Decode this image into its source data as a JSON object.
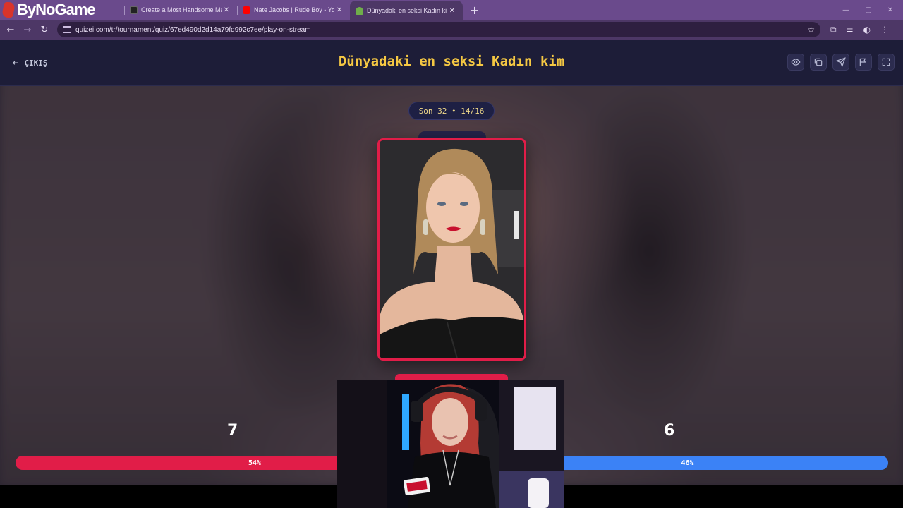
{
  "browser": {
    "brand": "ByNoGame",
    "tabs": [
      {
        "title": "Create a Most Handsome Male",
        "favicon_color": "#222222"
      },
      {
        "title": "Nate Jacobs | Rude Boy - YouTu",
        "favicon_color": "#ff0000"
      },
      {
        "title": "Dünyadaki en seksi Kadın kim -",
        "favicon_color": "#6fae4a",
        "active": true
      }
    ],
    "new_tab": "+",
    "url": "quizei.com/tr/tournament/quiz/67ed490d2d14a79fd992c7ee/play-on-stream"
  },
  "header": {
    "exit_label": "ÇIKIŞ",
    "title": "Dünyadaki en seksi Kadın kim",
    "actions": [
      "eye-icon",
      "copy-icon",
      "send-icon",
      "flag-icon",
      "fullscreen-icon"
    ]
  },
  "round": {
    "label": "Son 32 • 14/16"
  },
  "votes": {
    "left": {
      "count": "7",
      "percent_label": "54%",
      "percent": 54,
      "color": "#e11d48"
    },
    "right": {
      "count": "6",
      "percent_label": "46%",
      "percent": 46,
      "color": "#3b82f6"
    }
  },
  "colors": {
    "accent": "#f5c843",
    "card_border": "#e11d48"
  }
}
